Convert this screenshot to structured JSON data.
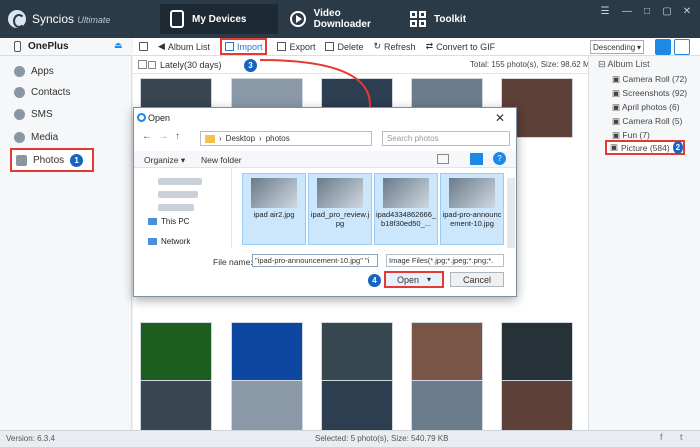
{
  "app": {
    "name": "Syncios",
    "edition": "Ultimate",
    "version": "Version: 6.3.4"
  },
  "nav": {
    "tabs": [
      "My Devices",
      "Video Downloader",
      "Toolkit"
    ]
  },
  "device": {
    "name": "OnePlus"
  },
  "sidebar": {
    "items": [
      "Apps",
      "Contacts",
      "SMS",
      "Media",
      "Photos"
    ]
  },
  "toolbar": {
    "album_list": "Album List",
    "import": "Import",
    "export": "Export",
    "delete": "Delete",
    "refresh": "Refresh",
    "convert": "Convert to GIF",
    "sort": "Descending"
  },
  "subbar": {
    "filter": "Lately(30 days)",
    "summary": "Total: 155 photo(s), Size: 98.62 MB"
  },
  "albums": {
    "title": "Album List",
    "items": [
      "Camera Roll (72)",
      "Screenshots (92)",
      "April photos (6)",
      "Camera Roll (5)",
      "Fun (7)",
      "Picture (584)"
    ]
  },
  "status": {
    "selected": "Selected: 5 photo(s), Size: 540.79 KB"
  },
  "steps": [
    "1",
    "2",
    "3",
    "4"
  ],
  "dialog": {
    "title": "Open",
    "path": [
      "Desktop",
      "photos"
    ],
    "search_placeholder": "Search photos",
    "organize": "Organize",
    "new_folder": "New folder",
    "nav_items": [
      "This PC",
      "Network"
    ],
    "files": [
      "ipad air2.jpg",
      "ipad_pro_review.jpg",
      "ipad4334862666_b18f30ed50_...",
      "ipad-pro-announcement-10.jpg"
    ],
    "file_name_label": "File name:",
    "file_name_value": "\"ipad-pro-announcement-10.jpg\" \"i",
    "file_type": "Image Files(*.jpg;*.jpeg;*.png;*.",
    "open": "Open",
    "cancel": "Cancel"
  },
  "colors": {
    "accent": "#1e88e5",
    "highlight": "#e53935",
    "titlebar": "#2b3a47"
  }
}
